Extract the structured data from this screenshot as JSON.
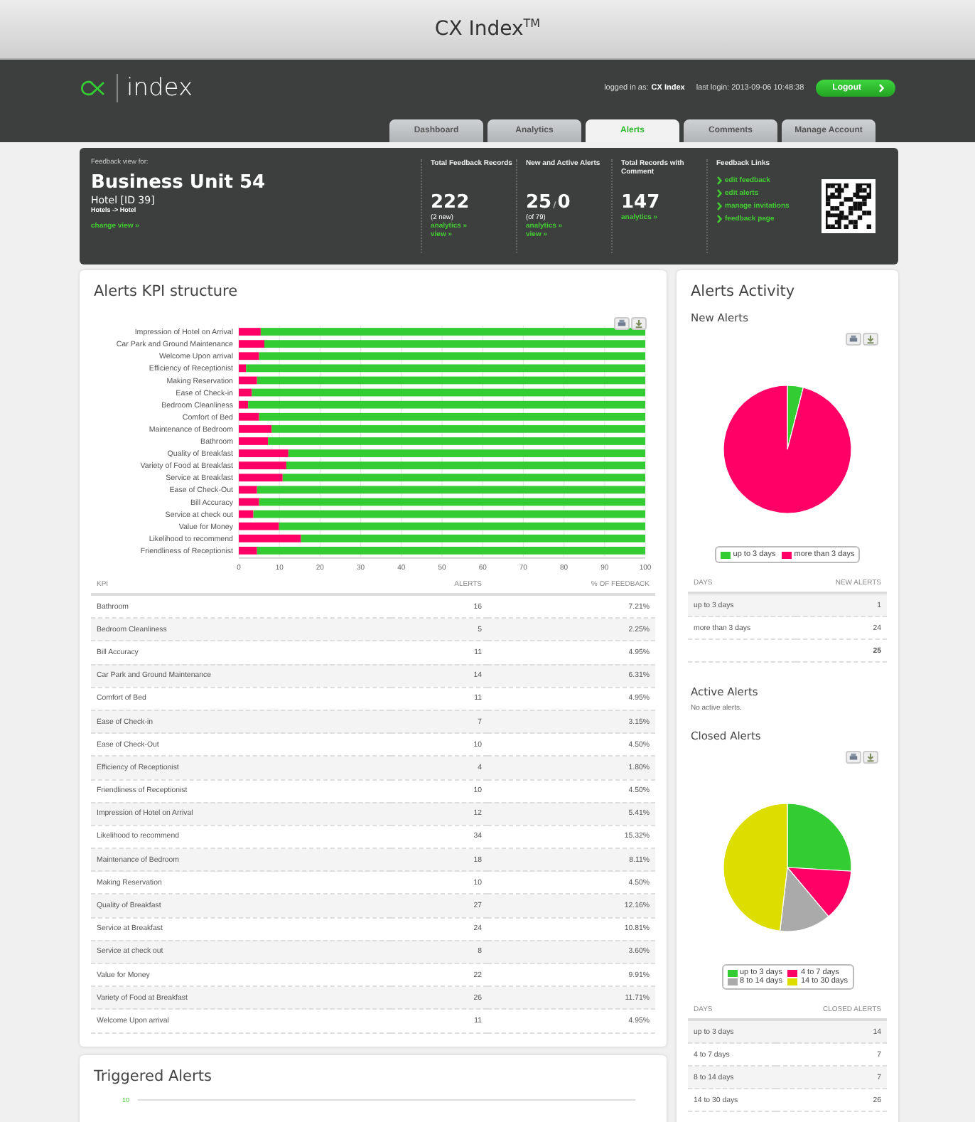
{
  "window": {
    "title": "CX Index$^{TM}$"
  },
  "header": {
    "logo_text": "index",
    "login_label": "logged in as:",
    "user": "CX Index",
    "last_login": "last login: 2013-09-06 10:48:38",
    "logout": "Logout"
  },
  "tabs": [
    {
      "label": "Dashboard",
      "selected": false
    },
    {
      "label": "Analytics",
      "selected": false
    },
    {
      "label": "Alerts",
      "selected": true
    },
    {
      "label": "Comments",
      "selected": false
    },
    {
      "label": "Manage Account",
      "selected": false
    }
  ],
  "summary": {
    "view_label": "Feedback view for:",
    "unit": "Business Unit 54",
    "hotel": "Hotel [ID 39]",
    "path": "Hotels -> Hotel",
    "change_view": "change view »",
    "stats": [
      {
        "title": "Total Feedback Records",
        "value": "222",
        "note": "(2 new)",
        "links": [
          "analytics »",
          "view »"
        ]
      },
      {
        "title": "New and Active Alerts",
        "value": "25",
        "separator": "/",
        "value_2": "0",
        "note": "(of 79)",
        "links": [
          "analytics »",
          "view »"
        ]
      },
      {
        "title": "Total Records with Comment",
        "value": "147",
        "links": [
          "analytics »"
        ]
      }
    ],
    "feedback_links": {
      "title": "Feedback Links",
      "links": [
        "edit feedback",
        "edit alerts",
        "manage invitations",
        "feedback page"
      ]
    }
  },
  "kpi_card": {
    "title": "Alerts KPI structure",
    "chart_data": {
      "type": "bar",
      "orientation": "horizontal",
      "stacked": true,
      "grid": true,
      "xlim": [
        0,
        100
      ],
      "xticks": [
        0,
        10,
        20,
        30,
        40,
        50,
        60,
        70,
        80,
        90,
        100
      ],
      "categories": [
        "Impression of Hotel on Arrival",
        "Car Park and Ground Maintenance",
        "Welcome Upon arrival",
        "Efficiency of Receptionist",
        "Making Reservation",
        "Ease of Check-in",
        "Bedroom Cleanliness",
        "Comfort of Bed",
        "Maintenance of Bedroom",
        "Bathroom",
        "Quality of Breakfast",
        "Variety of Food at Breakfast",
        "Service at Breakfast",
        "Ease of Check-Out",
        "Bill Accuracy",
        "Service at check out",
        "Value for Money",
        "Likelihood to recommend",
        "Friendliness of Receptionist"
      ],
      "series": [
        {
          "color": "#ff0066",
          "values": [
            5.4,
            6.3,
            5,
            1.8,
            4.5,
            3.2,
            2.3,
            5,
            8.1,
            7.2,
            12.2,
            11.7,
            10.8,
            4.5,
            5,
            3.6,
            9.9,
            15.3,
            4.5
          ]
        },
        {
          "color": "#33cc33",
          "values": [
            94.6,
            93.7,
            95,
            98.2,
            95.5,
            96.8,
            97.7,
            95,
            91.9,
            92.8,
            87.8,
            88.3,
            89.2,
            95.5,
            95,
            96.4,
            90.1,
            84.7,
            95.5
          ]
        }
      ]
    },
    "table": {
      "columns": [
        "KPI",
        "ALERTS",
        "% OF FEEDBACK"
      ],
      "rows": [
        [
          "Bathroom",
          "16",
          "7.21%"
        ],
        [
          "Bedroom Cleanliness",
          "5",
          "2.25%"
        ],
        [
          "Bill Accuracy",
          "11",
          "4.95%"
        ],
        [
          "Car Park and Ground Maintenance",
          "14",
          "6.31%"
        ],
        [
          "Comfort of Bed",
          "11",
          "4.95%"
        ],
        [
          "Ease of Check-in",
          "7",
          "3.15%"
        ],
        [
          "Ease of Check-Out",
          "10",
          "4.50%"
        ],
        [
          "Efficiency of Receptionist",
          "4",
          "1.80%"
        ],
        [
          "Friendliness of Receptionist",
          "10",
          "4.50%"
        ],
        [
          "Impression of Hotel on Arrival",
          "12",
          "5.41%"
        ],
        [
          "Likelihood to recommend",
          "34",
          "15.32%"
        ],
        [
          "Maintenance of Bedroom",
          "18",
          "8.11%"
        ],
        [
          "Making Reservation",
          "10",
          "4.50%"
        ],
        [
          "Quality of Breakfast",
          "27",
          "12.16%"
        ],
        [
          "Service at Breakfast",
          "24",
          "10.81%"
        ],
        [
          "Service at check out",
          "8",
          "3.60%"
        ],
        [
          "Value for Money",
          "22",
          "9.91%"
        ],
        [
          "Variety of Food at Breakfast",
          "26",
          "11.71%"
        ],
        [
          "Welcome Upon arrival",
          "11",
          "4.95%"
        ]
      ]
    }
  },
  "activity": {
    "title": "Alerts Activity",
    "sections": [
      {
        "kind": "pie",
        "title": "New Alerts",
        "chart_data": {
          "type": "pie",
          "categories": [
            "up to 3 days",
            "more than 3 days"
          ],
          "values": [
            4,
            96
          ],
          "colors": [
            "#33cc33",
            "#ff0066"
          ]
        },
        "table": {
          "columns": [
            "DAYS",
            "NEW ALERTS"
          ],
          "rows": [
            [
              "up to 3 days",
              "1"
            ],
            [
              "more than 3 days",
              "24"
            ]
          ],
          "total": "25"
        }
      },
      {
        "kind": "message",
        "title": "Active Alerts",
        "message": "No active alerts."
      },
      {
        "kind": "pie",
        "title": "Closed Alerts",
        "chart_data": {
          "type": "pie",
          "categories": [
            "up to 3 days",
            "4 to 7 days",
            "8 to 14 days",
            "14 to 30 days"
          ],
          "values": [
            14,
            7,
            7,
            26
          ],
          "colors": [
            "#33cc33",
            "#ff0066",
            "#aaaaaa",
            "#dddd00"
          ]
        },
        "table": {
          "columns": [
            "DAYS",
            "CLOSED ALERTS"
          ],
          "rows": [
            [
              "up to 3 days",
              "14"
            ],
            [
              "4 to 7 days",
              "7"
            ],
            [
              "8 to 14 days",
              "7"
            ],
            [
              "14 to 30 days",
              "26"
            ]
          ]
        }
      }
    ]
  },
  "triggered": {
    "title": "Triggered Alerts",
    "y_tick": "10"
  }
}
